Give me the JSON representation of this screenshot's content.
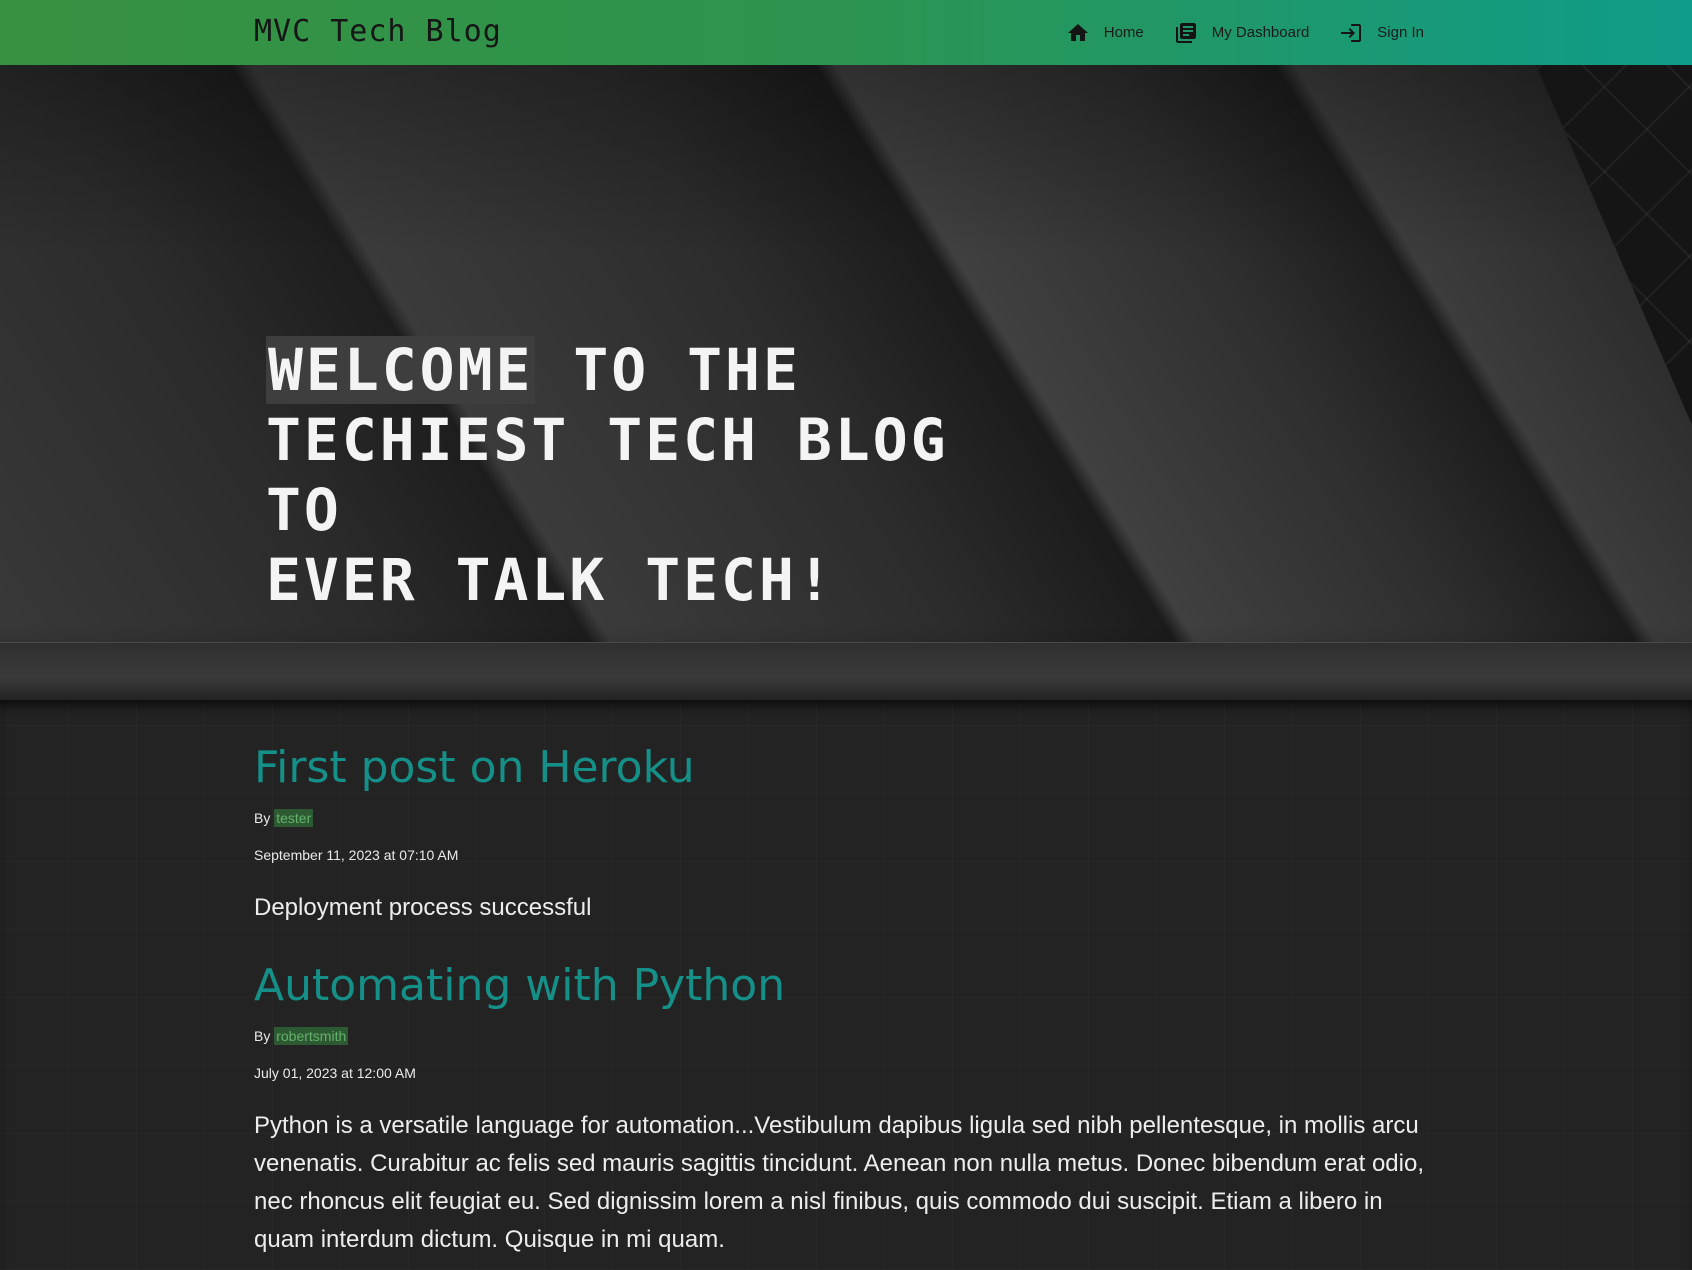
{
  "navbar": {
    "brand": "MVC Tech Blog",
    "links": [
      {
        "label": "Home",
        "icon": "home-icon"
      },
      {
        "label": "My Dashboard",
        "icon": "dashboard-icon"
      },
      {
        "label": "Sign In",
        "icon": "sign-in-icon"
      }
    ],
    "gradient_start": "#379140",
    "gradient_end": "#0f9c8a"
  },
  "hero": {
    "highlight_word": "Welcome",
    "title_rest_line1": " to the",
    "title_line2": "Techiest Tech Blog to",
    "title_line3": "ever talk tech!"
  },
  "posts": [
    {
      "title": "First post on Heroku",
      "by_label": "By",
      "author": "tester",
      "date": "September 11, 2023 at 07:10 AM",
      "body": "Deployment process successful"
    },
    {
      "title": "Automating with Python",
      "by_label": "By",
      "author": "robertsmith",
      "date": "July 01, 2023 at 12:00 AM",
      "body": "Python is a versatile language for automation...Vestibulum dapibus ligula sed nibh pellentesque, in mollis arcu venenatis. Curabitur ac felis sed mauris sagittis tincidunt. Aenean non nulla metus. Donec bibendum erat odio, nec rhoncus elit feugiat eu. Sed dignissim lorem a nisl finibus, quis commodo dui suscipit. Etiam a libero in quam interdum dictum. Quisque in mi quam."
    }
  ],
  "colors": {
    "accent": "#159088",
    "author_bg": "#2e5a33",
    "author_text": "#63b26c",
    "background": "#232323"
  }
}
